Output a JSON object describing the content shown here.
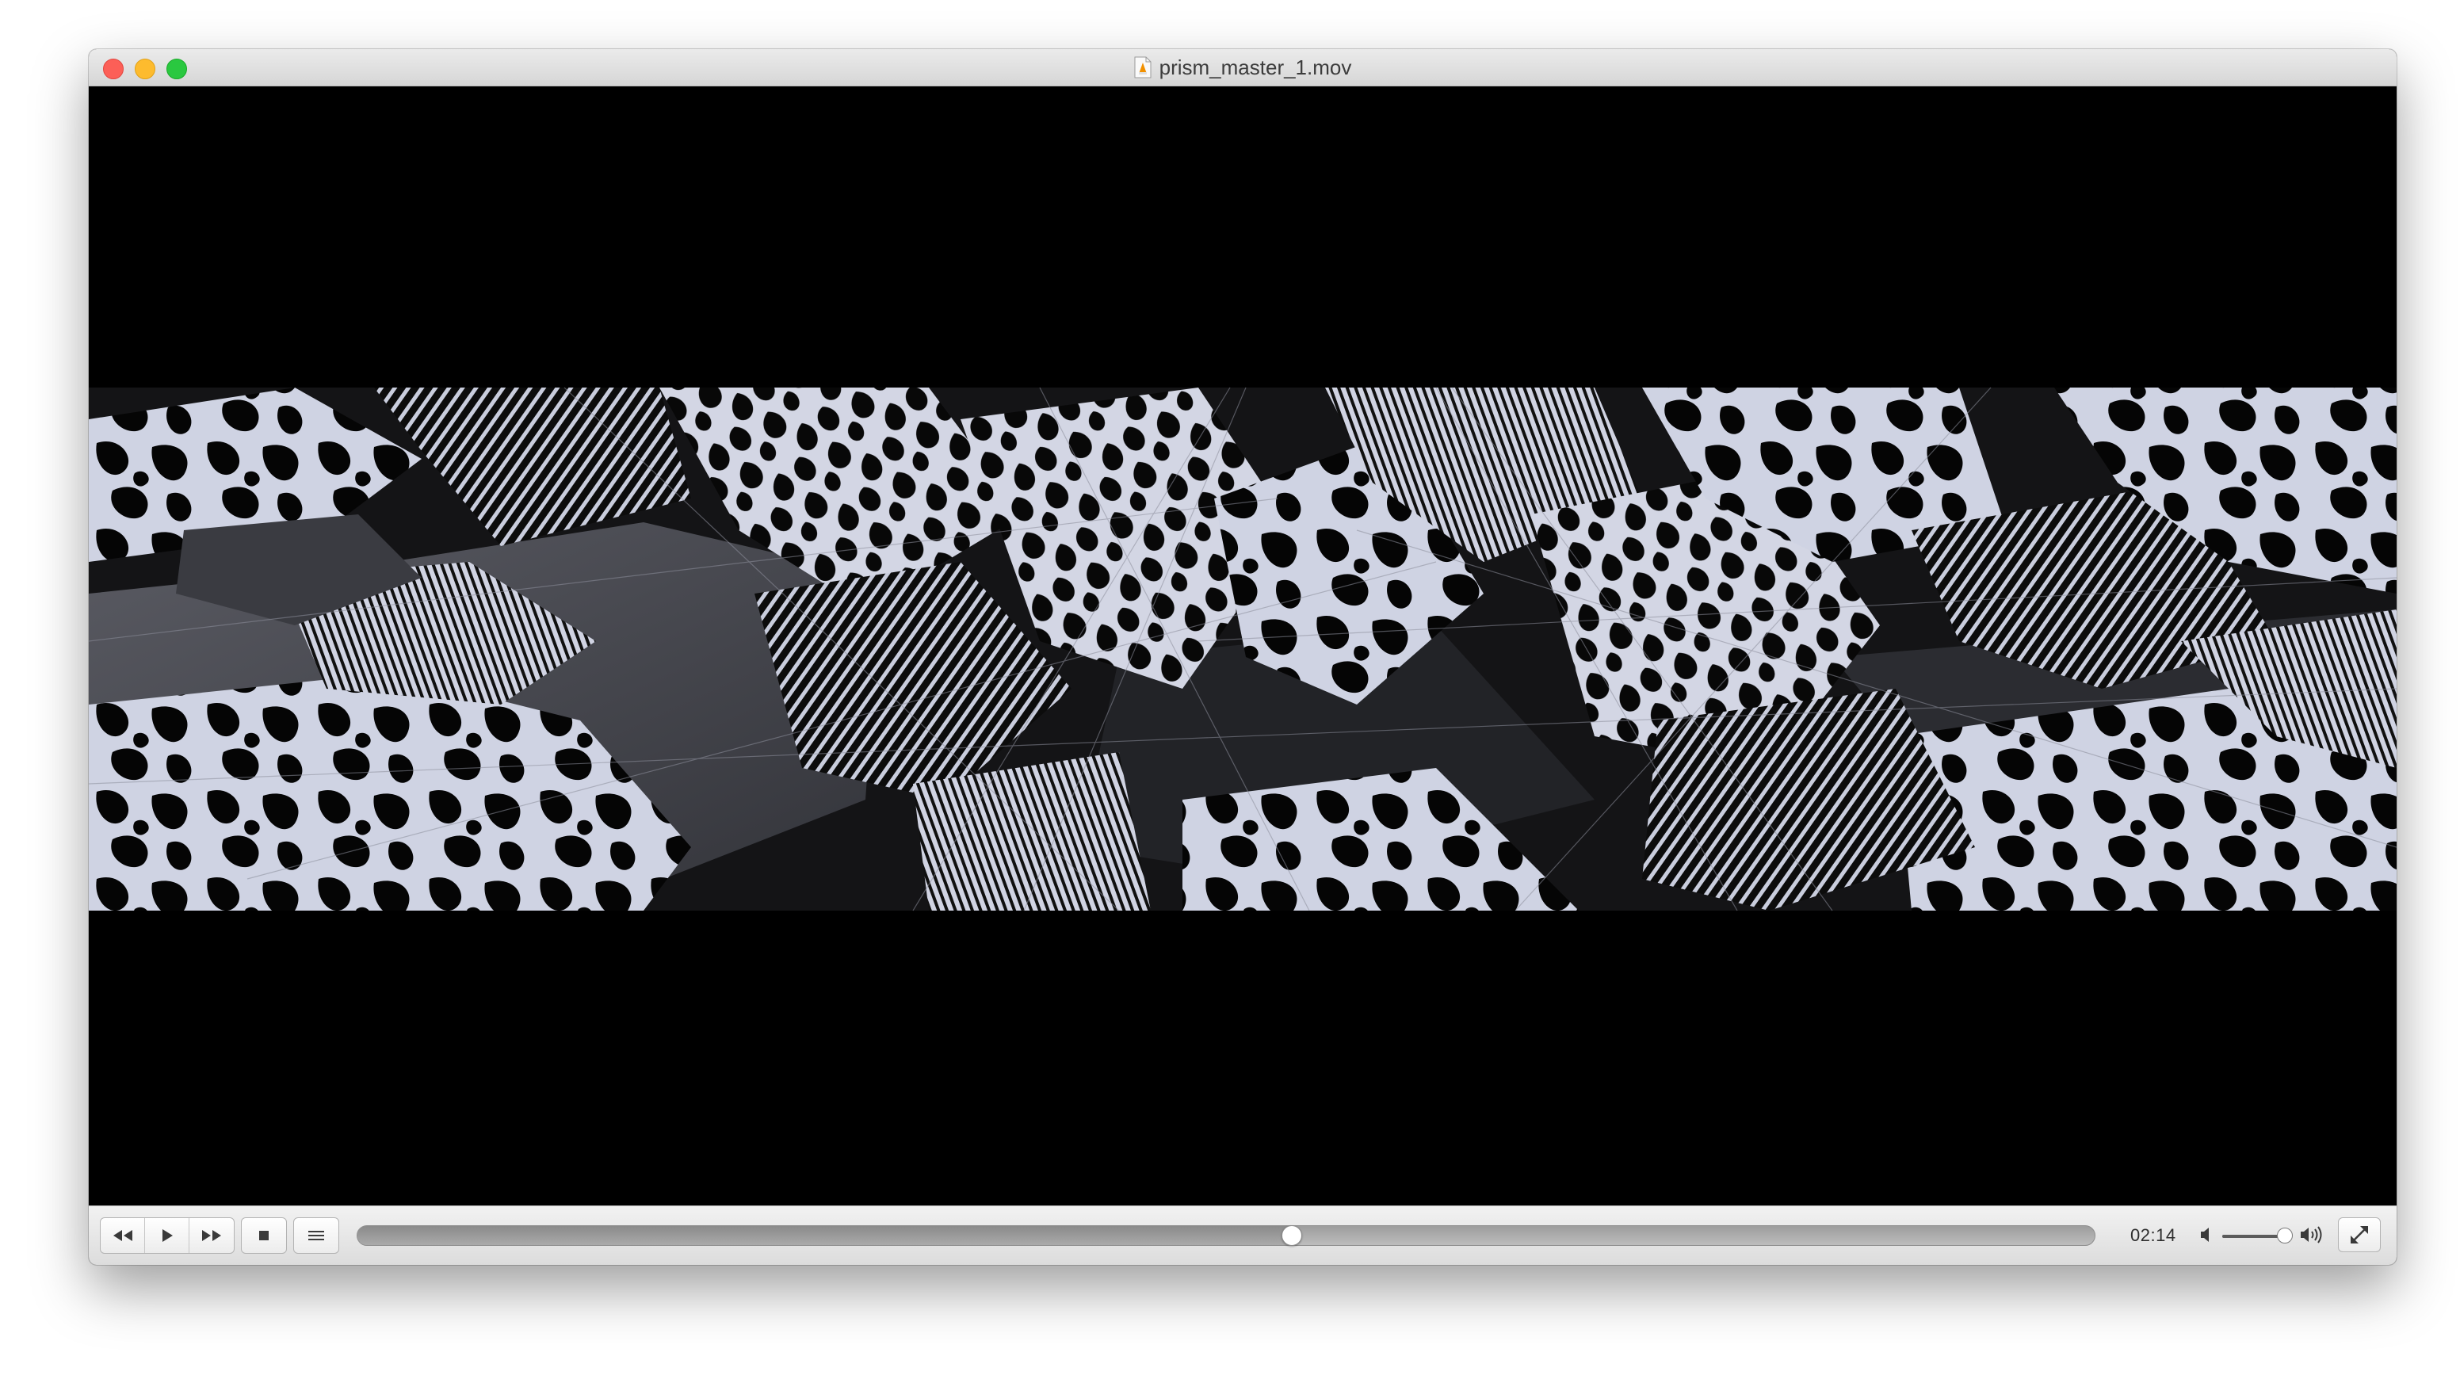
{
  "window": {
    "title": "prism_master_1.mov",
    "file_icon": "vlc-document-icon"
  },
  "traffic_lights": {
    "close": "close-button",
    "minimize": "minimize-button",
    "zoom": "zoom-button"
  },
  "video": {
    "description_icon": "video-frame"
  },
  "controls": {
    "rewind_icon": "rewind-icon",
    "play_icon": "play-icon",
    "fast_forward_icon": "fast-forward-icon",
    "stop_icon": "stop-icon",
    "playlist_icon": "playlist-icon",
    "progress_fraction": 0.538,
    "elapsed_time": "02:14",
    "volume_low_icon": "speaker-low-icon",
    "volume_high_icon": "speaker-high-icon",
    "volume_level": 0.9,
    "fullscreen_icon": "fullscreen-icon"
  },
  "colors": {
    "close": "#fc5f57",
    "minimize": "#fdbb2e",
    "zoom": "#2ac840",
    "video_background": "#000000",
    "pattern_light": "#cfd3e3",
    "pattern_mid": "#4a4b52"
  }
}
